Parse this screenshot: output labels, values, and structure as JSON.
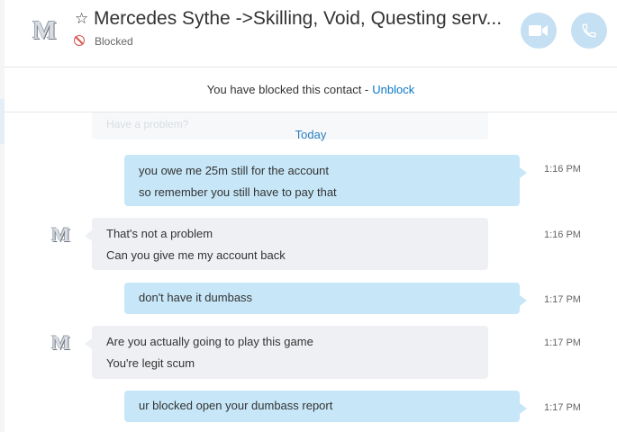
{
  "header": {
    "avatar_letter": "M",
    "title": "Mercedes Sythe ->Skilling, Void, Questing serv...",
    "status": "Blocked",
    "video_call_icon": "video-camera-icon",
    "audio_call_icon": "phone-icon"
  },
  "banner": {
    "text": "You have blocked this contact -",
    "unblock_label": "Unblock"
  },
  "chat": {
    "ghost_text": "Have a problem?",
    "day_separator": "Today",
    "messages": [
      {
        "direction": "out",
        "lines": [
          "you owe me 25m still for the account",
          "so remember you still have to pay that"
        ],
        "time": "1:16 PM"
      },
      {
        "direction": "in",
        "lines": [
          "That's not a problem",
          "Can you give me my account back"
        ],
        "time": "1:16 PM"
      },
      {
        "direction": "out",
        "lines": [
          "don't have it dumbass"
        ],
        "time": "1:17 PM"
      },
      {
        "direction": "in",
        "lines": [
          "Are you actually going to play this game",
          "You're legit scum"
        ],
        "time": "1:17 PM"
      },
      {
        "direction": "out",
        "lines": [
          "ur blocked open your dumbass report"
        ],
        "time": "1:17 PM"
      }
    ]
  },
  "colors": {
    "outgoing_bubble": "#c7e7f8",
    "incoming_bubble": "#eef0f3",
    "link": "#0a78c8",
    "blocked": "#d9534f",
    "header_button": "#c5e0f2"
  }
}
